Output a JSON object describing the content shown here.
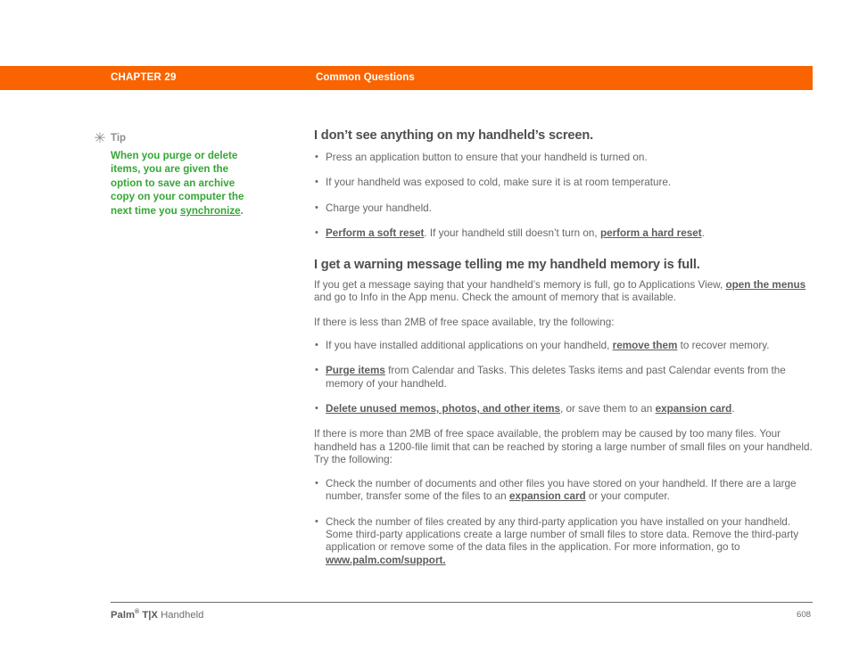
{
  "page": {
    "background_color": "#ffffff",
    "header_band_color": "#fa6400",
    "tip_text_color": "#35a735",
    "body_text_color": "#676767",
    "heading_text_color": "#4f4f4f"
  },
  "header": {
    "chapter": "CHAPTER 29",
    "section": "Common Questions"
  },
  "tip": {
    "icon": "asterisk-icon",
    "icon_glyph": "✳",
    "label": "Tip",
    "body_prefix": "When you purge or delete items, you are given the option to save an archive copy on your computer the next time you ",
    "body_link": "synchronize",
    "body_suffix": "."
  },
  "main": {
    "heading_1": "I don’t see anything on my handheld’s screen.",
    "bullets_1": [
      {
        "parts": [
          {
            "t": "Press an application button to ensure that your handheld is turned on.",
            "link": false
          }
        ]
      },
      {
        "parts": [
          {
            "t": "If your handheld was exposed to cold, make sure it is at room temperature.",
            "link": false
          }
        ]
      },
      {
        "parts": [
          {
            "t": "Charge your handheld.",
            "link": false
          }
        ]
      },
      {
        "parts": [
          {
            "t": "Perform a soft reset",
            "link": true
          },
          {
            "t": ". If your handheld still doesn’t turn on, ",
            "link": false
          },
          {
            "t": "perform a hard reset",
            "link": true
          },
          {
            "t": ".",
            "link": false
          }
        ]
      }
    ],
    "heading_2": "I get a warning message telling me my handheld memory is full.",
    "paragraph_1": [
      {
        "t": "If you get a message saying that your handheld’s memory is full, go to Applications View, ",
        "link": false
      },
      {
        "t": "open the menus",
        "link": true
      },
      {
        "t": " and go to Info in the App menu. Check the amount of memory that is available.",
        "link": false
      }
    ],
    "paragraph_2": [
      {
        "t": "If there is less than 2MB of free space available, try the following:",
        "link": false
      }
    ],
    "bullets_2": [
      {
        "parts": [
          {
            "t": "If you have installed additional applications on your handheld, ",
            "link": false
          },
          {
            "t": "remove them",
            "link": true
          },
          {
            "t": " to recover memory.",
            "link": false
          }
        ]
      },
      {
        "parts": [
          {
            "t": "Purge items",
            "link": true
          },
          {
            "t": " from Calendar and Tasks. This deletes Tasks items and past Calendar events from the memory of your handheld.",
            "link": false
          }
        ]
      },
      {
        "parts": [
          {
            "t": "Delete unused memos, photos, and other items",
            "link": true
          },
          {
            "t": ", or save them to an ",
            "link": false
          },
          {
            "t": "expansion card",
            "link": true
          },
          {
            "t": ".",
            "link": false
          }
        ]
      }
    ],
    "paragraph_3": [
      {
        "t": "If there is more than 2MB of free space available, the problem may be caused by too many files. Your handheld has a 1200-file limit that can be reached by storing a large number of small files on your handheld. Try the following:",
        "link": false
      }
    ],
    "bullets_3": [
      {
        "parts": [
          {
            "t": "Check the number of documents and other files you have stored on your handheld. If there are a large number, transfer some of the files to an ",
            "link": false
          },
          {
            "t": "expansion card",
            "link": true
          },
          {
            "t": " or your computer.",
            "link": false
          }
        ]
      },
      {
        "parts": [
          {
            "t": "Check the number of files created by any third-party application you have installed on your handheld. Some third-party applications create a large number of small files to store data. Remove the third-party application or remove some of the data files in the application. For more information, go to ",
            "link": false
          },
          {
            "t": "www.palm.com/support.",
            "link": true
          }
        ]
      }
    ]
  },
  "footer": {
    "brand": "Palm",
    "registered_mark": "®",
    "model": "T|X",
    "product": "Handheld",
    "page_number": "608"
  }
}
